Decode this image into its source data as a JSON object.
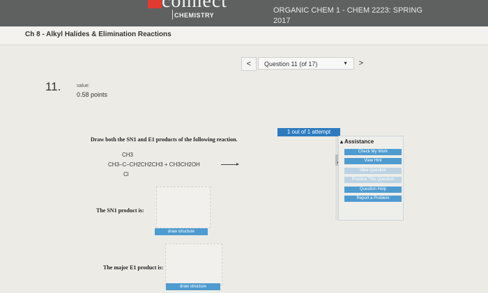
{
  "header": {
    "logo_text": "connect",
    "logo_sub": "CHEMISTRY",
    "course_title": "ORGANIC CHEM 1 - CHEM 2223: SPRING 2017",
    "bar_color": "#5f6161",
    "brand_red": "#e23b2e"
  },
  "chapter": {
    "title": "Ch 8 - Alkyl Halides & Elimination Reactions"
  },
  "question_nav": {
    "prev_icon": "<",
    "selected": "Question 11 (of 17)",
    "caret_icon": "▼",
    "next_icon": ">"
  },
  "question": {
    "number": "11.",
    "value_label": "value:",
    "points": "0.58 points",
    "prompt": "Draw both the SN1 and E1 products of the following reaction.",
    "reaction": {
      "line1": "CH3",
      "line2": "CH3–C–CH2CH2CH3   +   CH3CH2OH",
      "line3": "Cl"
    },
    "sn1_label": "The SN1 product is:",
    "e1_label": "The major E1 product is:",
    "draw_button_1": "draw structure",
    "draw_button_2": "draw structure"
  },
  "assistance": {
    "attempt_status": "1 out of 1 attempt",
    "title": "Assistance",
    "buttons": [
      {
        "label": "Check My Work",
        "color": "#4e9bd0"
      },
      {
        "label": "View Hint",
        "color": "#4e9bd0"
      },
      {
        "label": "View Question",
        "color": "#bcd3e4"
      },
      {
        "label": "Practice This Question",
        "color": "#bcd3e4"
      },
      {
        "label": "Question Help",
        "color": "#4e9bd0"
      },
      {
        "label": "Report a Problem",
        "color": "#4e9bd0"
      }
    ]
  }
}
